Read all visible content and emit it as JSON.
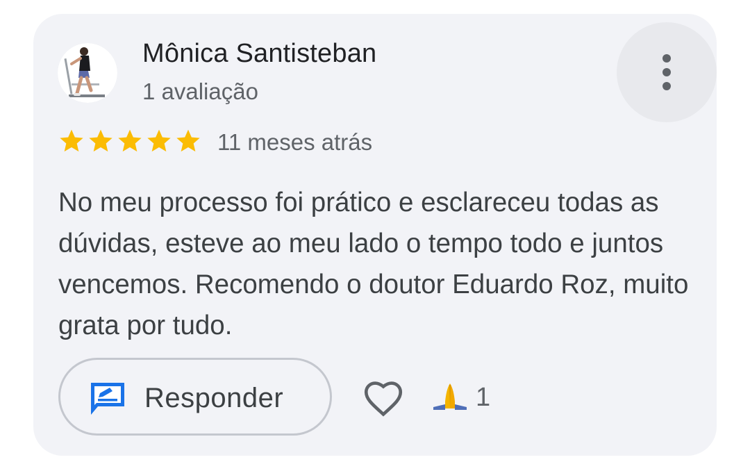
{
  "review": {
    "author_name": "Mônica Santisteban",
    "review_count": "1 avaliação",
    "rating": 5,
    "rating_max": 5,
    "time_ago": "11 meses atrás",
    "text": "No meu processo foi prático e esclareceu todas as dúvidas, esteve ao meu lado o tempo todo e juntos vencemos. Recomendo o doutor Eduardo Roz, muito grata por tudo."
  },
  "actions": {
    "reply_label": "Responder",
    "reaction_icon": "folded-hands-emoji",
    "reaction_count": "1",
    "like_icon": "heart-outline-icon",
    "more_icon": "more-vert-icon",
    "reply_icon": "reply-edit-icon"
  },
  "colors": {
    "card_bg": "#f2f3f7",
    "star": "#fbbc04",
    "reply_icon": "#1a73e8",
    "text": "#3c4043",
    "muted": "#5f6368"
  }
}
